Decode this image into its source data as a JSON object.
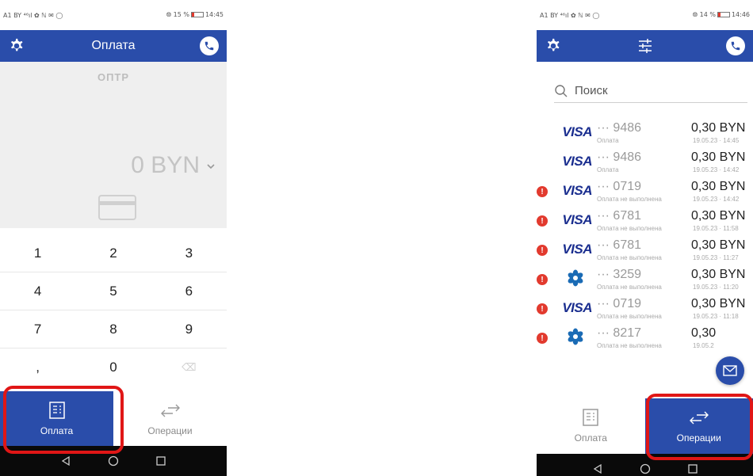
{
  "left": {
    "status": {
      "left": "A1 BY ⁴⁶ıl ✿ ℕ ✉ ◯",
      "right_prefix": "⨷ 15 %",
      "time": "14:45"
    },
    "header": {
      "title": "Оплата"
    },
    "terminal": "ОПТР",
    "amount": "0 BYN",
    "keypad": [
      [
        "1",
        "2",
        "3"
      ],
      [
        "4",
        "5",
        "6"
      ],
      [
        "7",
        "8",
        "9"
      ],
      [
        ",",
        "0",
        "⌫"
      ]
    ],
    "nav": {
      "pay": "Оплата",
      "ops": "Операции"
    }
  },
  "right": {
    "status": {
      "left": "A1 BY ⁴⁶ıl ✿ ℕ ✉ ◯",
      "right_prefix": "⨷ 14 %",
      "time": "14:46"
    },
    "search_placeholder": "Поиск",
    "transactions": [
      {
        "brand": "VISA",
        "failed": false,
        "pan": "··· 9486",
        "status": "Оплата",
        "amount": "0,30 BYN",
        "time": "19.05.23 · 14:45"
      },
      {
        "brand": "VISA",
        "failed": false,
        "pan": "··· 9486",
        "status": "Оплата",
        "amount": "0,30 BYN",
        "time": "19.05.23 · 14:42"
      },
      {
        "brand": "VISA",
        "failed": true,
        "pan": "··· 0719",
        "status": "Оплата не выполнена",
        "amount": "0,30 BYN",
        "time": "19.05.23 · 14:42"
      },
      {
        "brand": "VISA",
        "failed": true,
        "pan": "··· 6781",
        "status": "Оплата не выполнена",
        "amount": "0,30 BYN",
        "time": "19.05.23 · 11:58"
      },
      {
        "brand": "VISA",
        "failed": true,
        "pan": "··· 6781",
        "status": "Оплата не выполнена",
        "amount": "0,30 BYN",
        "time": "19.05.23 · 11:27"
      },
      {
        "brand": "BELKART",
        "failed": true,
        "pan": "··· 3259",
        "status": "Оплата не выполнена",
        "amount": "0,30 BYN",
        "time": "19.05.23 · 11:20"
      },
      {
        "brand": "VISA",
        "failed": true,
        "pan": "··· 0719",
        "status": "Оплата не выполнена",
        "amount": "0,30 BYN",
        "time": "19.05.23 · 11:18"
      },
      {
        "brand": "BELKART",
        "failed": true,
        "pan": "··· 8217",
        "status": "Оплата не выполнена",
        "amount": "0,30",
        "time": "19.05.2"
      }
    ],
    "nav": {
      "pay": "Оплата",
      "ops": "Операции"
    }
  },
  "colors": {
    "primary": "#2a4daa",
    "alert": "#e23a2e",
    "highlight": "#e01616",
    "visa": "#1a2e8f"
  }
}
